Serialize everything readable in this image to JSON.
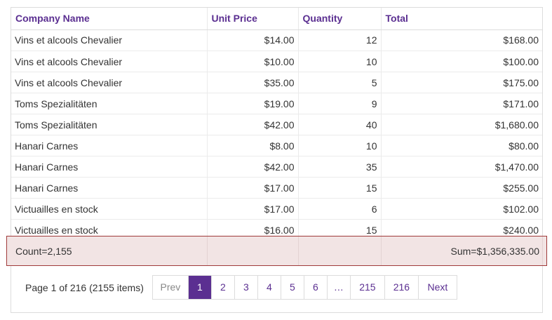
{
  "columns": [
    "Company Name",
    "Unit Price",
    "Quantity",
    "Total"
  ],
  "rows": [
    [
      "Vins et alcools Chevalier",
      "$14.00",
      "12",
      "$168.00"
    ],
    [
      "Vins et alcools Chevalier",
      "$10.00",
      "10",
      "$100.00"
    ],
    [
      "Vins et alcools Chevalier",
      "$35.00",
      "5",
      "$175.00"
    ],
    [
      "Toms Spezialitäten",
      "$19.00",
      "9",
      "$171.00"
    ],
    [
      "Toms Spezialitäten",
      "$42.00",
      "40",
      "$1,680.00"
    ],
    [
      "Hanari Carnes",
      "$8.00",
      "10",
      "$80.00"
    ],
    [
      "Hanari Carnes",
      "$42.00",
      "35",
      "$1,470.00"
    ],
    [
      "Hanari Carnes",
      "$17.00",
      "15",
      "$255.00"
    ],
    [
      "Victuailles en stock",
      "$17.00",
      "6",
      "$102.00"
    ],
    [
      "Victuailles en stock",
      "$16.00",
      "15",
      "$240.00"
    ]
  ],
  "summary": {
    "count": "Count=2,155",
    "sum": "Sum=$1,356,335.00"
  },
  "pager": {
    "info": "Page 1 of 216 (2155 items)",
    "prev": "Prev",
    "pages": [
      "1",
      "2",
      "3",
      "4",
      "5",
      "6",
      "…",
      "215",
      "216"
    ],
    "next": "Next",
    "current": "1"
  },
  "colors": {
    "accent": "#5b2f91",
    "summary_bg": "#f2e4e4",
    "summary_border": "#a03a3a"
  }
}
